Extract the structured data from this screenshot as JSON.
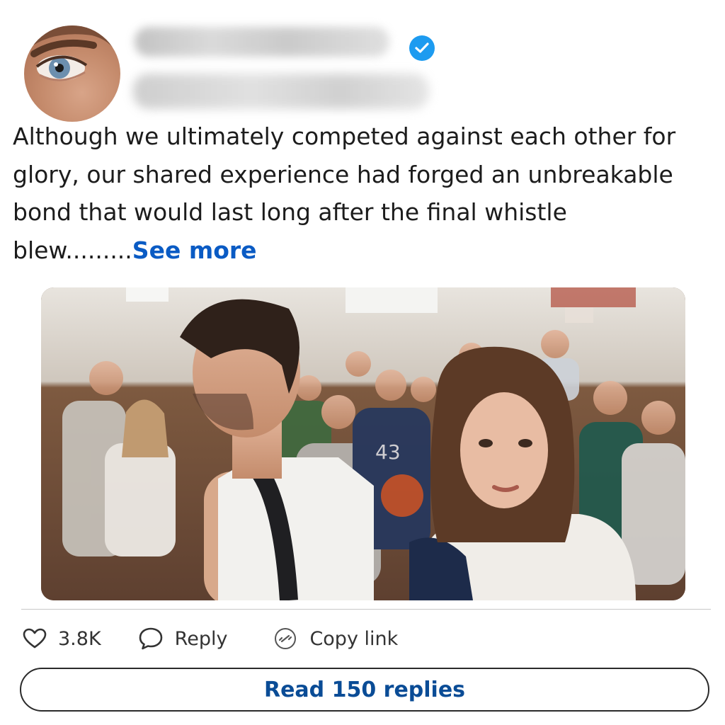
{
  "post": {
    "text": "Although we ultimately competed against each other for glory, our shared experience had forged an unbreakable bond that would last long after the final whistle blew.........",
    "see_more_label": "See more"
  },
  "actions": {
    "like_count": "3.8K",
    "reply_label": "Reply",
    "copy_link_label": "Copy link"
  },
  "read_replies_label": "Read 150 replies",
  "icons": {
    "verified": "verified-badge-icon",
    "like": "heart-icon",
    "reply": "speech-bubble-icon",
    "copy": "link-icon"
  },
  "colors": {
    "verified": "#1d9bf0",
    "link_blue": "#0a5bc4",
    "button_text": "#0a4c96"
  }
}
